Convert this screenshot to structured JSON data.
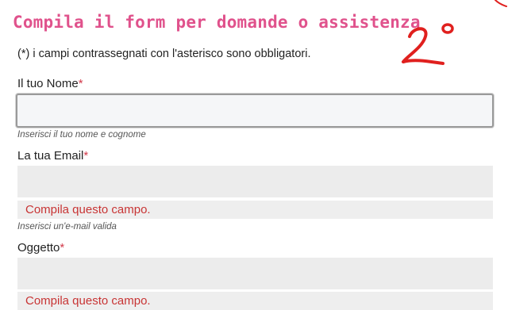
{
  "form": {
    "title": "Compila il form per domande o assistenza",
    "intro": "(*) i campi contrassegnati con l'asterisco sono obbligatori.",
    "required_marker": "*",
    "fields": [
      {
        "label": "Il tuo Nome",
        "value": "",
        "hint": "Inserisci il tuo nome e cognome",
        "error": ""
      },
      {
        "label": "La tua Email",
        "value": "",
        "hint": "Inserisci un'e-mail valida",
        "error": "Compila questo campo."
      },
      {
        "label": "Oggetto",
        "value": "",
        "hint": "",
        "error": "Compila questo campo."
      }
    ]
  },
  "annotation": {
    "text": "2°",
    "color": "#e0201e"
  },
  "colors": {
    "title": "#e0528c",
    "required": "#d23a4a",
    "error_text": "#c83434",
    "input_bg": "#ececec"
  }
}
